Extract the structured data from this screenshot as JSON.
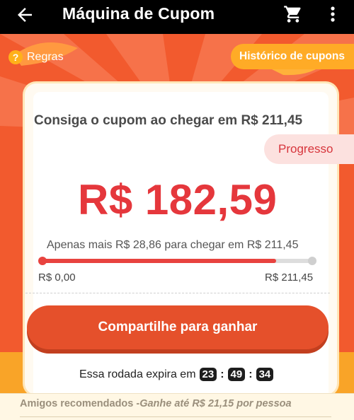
{
  "appbar": {
    "title": "Máquina de Cupom",
    "back_icon": "back-arrow-icon",
    "cart_icon": "shopping-cart-icon",
    "more_icon": "more-vertical-icon"
  },
  "top": {
    "rules_label": "Regras",
    "rules_icon_glyph": "?",
    "history_label": "Histórico de cupons"
  },
  "card": {
    "headline": "Consiga o cupom ao chegar em R$ 211,45",
    "progress_tag": "Progresso",
    "amount": "R$ 182,59",
    "subline": "Apenas mais R$ 28,86 para chegar em R$ 211,45",
    "progress": {
      "current": 182.59,
      "target": 211.45,
      "fraction": 0.8635
    },
    "min_label": "R$ 0,00",
    "max_label": "R$ 211,45",
    "share_button": "Compartilhe para ganhar",
    "expire_label": "Essa rodada expira em",
    "timer": {
      "hours": "23",
      "minutes": "49",
      "seconds": "34",
      "sep": ":"
    }
  },
  "friends": {
    "label": "Amigos recomendados -",
    "reward": "Ganhe até R$ 21,15 por pessoa"
  },
  "colors": {
    "accent_red": "#e5373c",
    "button_orange": "#e5502b",
    "pill_orange": "#ffab26",
    "hero_bg": "#f25a2e"
  }
}
